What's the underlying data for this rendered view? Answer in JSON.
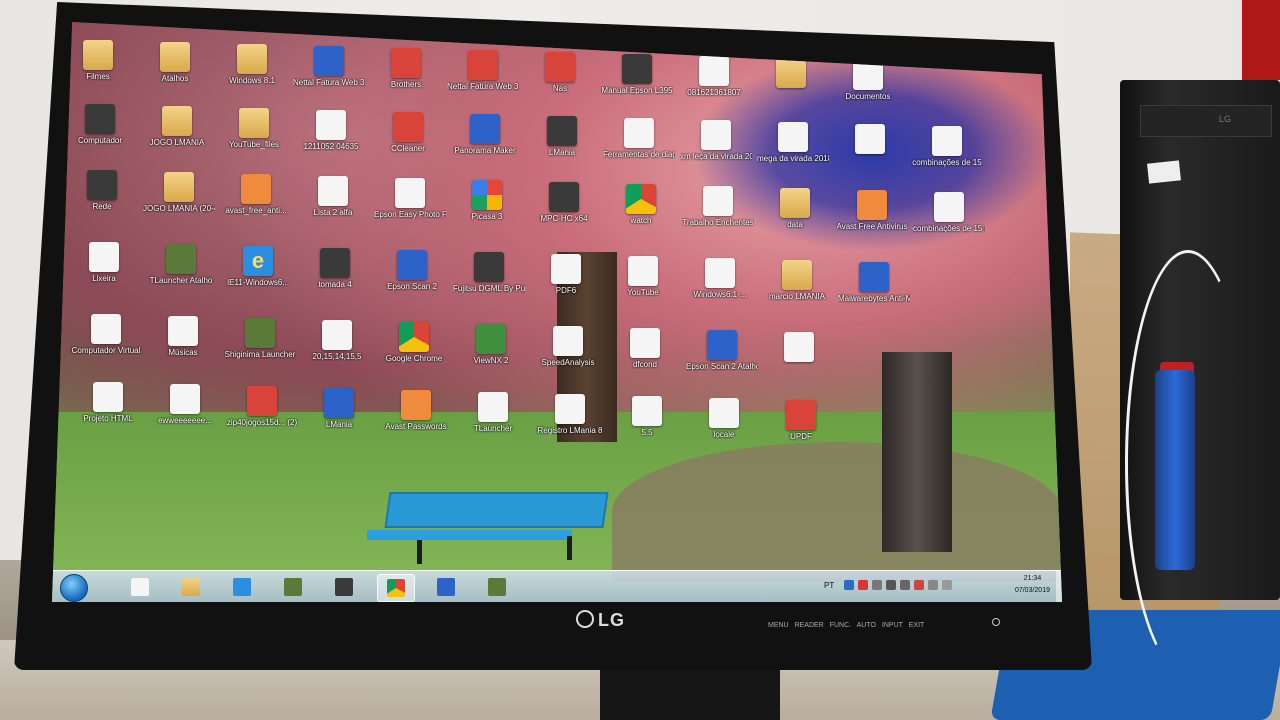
{
  "monitor": {
    "brand": "LG",
    "buttons": [
      "MENU",
      "READER",
      "FUNC.",
      "AUTO",
      "INPUT",
      "EXIT"
    ]
  },
  "desktop": {
    "icons": [
      {
        "name": "folder",
        "label": "Filmes",
        "glyph": "g-folder"
      },
      {
        "name": "folder",
        "label": "Atalhos",
        "glyph": "g-folder"
      },
      {
        "name": "folder",
        "label": "Windows 8.1",
        "glyph": "g-folder"
      },
      {
        "name": "app",
        "label": "Nettal Fatura Web 3.0",
        "glyph": "g-blue"
      },
      {
        "name": "app",
        "label": "Brothers",
        "glyph": "g-red"
      },
      {
        "name": "app",
        "label": "Nettal Fatura Web 3.0",
        "glyph": "g-red"
      },
      {
        "name": "app",
        "label": "Nas",
        "glyph": "g-red"
      },
      {
        "name": "app",
        "label": "Manual Epson L395",
        "glyph": "g-dark"
      },
      {
        "name": "doc",
        "label": "081621361807",
        "glyph": "g-doc"
      },
      {
        "name": "folder",
        "label": "",
        "glyph": "g-folder"
      },
      {
        "name": "doc",
        "label": "Documentos",
        "glyph": "g-doc"
      },
      {
        "name": "computer",
        "label": "Computador",
        "glyph": "g-dark"
      },
      {
        "name": "folder",
        "label": "JOGO LMANIA",
        "glyph": "g-folder"
      },
      {
        "name": "folder",
        "label": "YouTube_files",
        "glyph": "g-folder"
      },
      {
        "name": "app",
        "label": "1211052 04635",
        "glyph": "g-doc"
      },
      {
        "name": "app",
        "label": "CCleaner",
        "glyph": "g-red"
      },
      {
        "name": "app",
        "label": "Panorama Maker",
        "glyph": "g-blue"
      },
      {
        "name": "app",
        "label": "LMania",
        "glyph": "g-dark"
      },
      {
        "name": "doc",
        "label": "Ferramentas de diagnóstico d...",
        "glyph": "g-doc"
      },
      {
        "name": "doc",
        "label": "xm leça da virada 2018",
        "glyph": "g-doc"
      },
      {
        "name": "doc",
        "label": "mega da virada 2018",
        "glyph": "g-doc"
      },
      {
        "name": "doc",
        "label": "",
        "glyph": "g-doc"
      },
      {
        "name": "doc",
        "label": "combinações de 15",
        "glyph": "g-doc"
      },
      {
        "name": "network",
        "label": "Rede",
        "glyph": "g-dark"
      },
      {
        "name": "folder",
        "label": "JOGO LMANIA (20-40)",
        "glyph": "g-folder"
      },
      {
        "name": "app",
        "label": "avast_free_anti...",
        "glyph": "g-orange"
      },
      {
        "name": "doc",
        "label": "Lista 2 alfa",
        "glyph": "g-doc"
      },
      {
        "name": "app",
        "label": "Epson Easy Photo Print",
        "glyph": "g-doc"
      },
      {
        "name": "app",
        "label": "Picasa 3",
        "glyph": "g-picasa"
      },
      {
        "name": "app",
        "label": "MPC-HC x64",
        "glyph": "g-dark"
      },
      {
        "name": "app",
        "label": "watch",
        "glyph": "g-chrome"
      },
      {
        "name": "doc",
        "label": "Trabalho Enchentes",
        "glyph": "g-doc"
      },
      {
        "name": "folder",
        "label": "data",
        "glyph": "g-folder"
      },
      {
        "name": "app",
        "label": "Avast Free Antivirus",
        "glyph": "g-orange"
      },
      {
        "name": "doc",
        "label": "combinações de 15 dezenas (2)",
        "glyph": "g-doc"
      },
      {
        "name": "trash",
        "label": "Lixeira",
        "glyph": "g-doc"
      },
      {
        "name": "app",
        "label": "TLauncher Atalho",
        "glyph": "g-cube"
      },
      {
        "name": "app",
        "label": "IE11-Windows6...",
        "glyph": "g-ie"
      },
      {
        "name": "app",
        "label": "tomada 4",
        "glyph": "g-dark"
      },
      {
        "name": "app",
        "label": "Epson Scan 2",
        "glyph": "g-blue"
      },
      {
        "name": "app",
        "label": "Fujitsu DGML By Pulse 14",
        "glyph": "g-dark"
      },
      {
        "name": "doc",
        "label": "PDF6",
        "glyph": "g-doc"
      },
      {
        "name": "doc",
        "label": "YouTube",
        "glyph": "g-doc"
      },
      {
        "name": "app",
        "label": "Windows6.1-...",
        "glyph": "g-doc"
      },
      {
        "name": "folder",
        "label": "marcio LMANIA",
        "glyph": "g-folder"
      },
      {
        "name": "app",
        "label": "Malwarebytes Anti-Malware",
        "glyph": "g-blue"
      },
      {
        "name": "folder",
        "label": "Computador Virtual",
        "glyph": "g-doc"
      },
      {
        "name": "folder",
        "label": "Músicas",
        "glyph": "g-doc"
      },
      {
        "name": "app",
        "label": "Shiginima Launcher",
        "glyph": "g-cube"
      },
      {
        "name": "doc",
        "label": "20,15,14,15,5",
        "glyph": "g-doc"
      },
      {
        "name": "app",
        "label": "Google Chrome",
        "glyph": "g-chrome"
      },
      {
        "name": "app",
        "label": "ViewNX 2",
        "glyph": "g-green"
      },
      {
        "name": "doc",
        "label": "SpeedAnalysis",
        "glyph": "g-doc"
      },
      {
        "name": "doc",
        "label": "dfcond",
        "glyph": "g-doc"
      },
      {
        "name": "app",
        "label": "Epson Scan 2 Atalho",
        "glyph": "g-blue"
      },
      {
        "name": "folder",
        "label": "",
        "glyph": "g-doc"
      },
      {
        "name": "folder",
        "label": "Projeto HTML",
        "glyph": "g-doc"
      },
      {
        "name": "folder",
        "label": "ewweeeeeee...",
        "glyph": "g-doc"
      },
      {
        "name": "archive",
        "label": "zip40jogos15d... (2)",
        "glyph": "g-red"
      },
      {
        "name": "app",
        "label": "LMania",
        "glyph": "g-blue"
      },
      {
        "name": "app",
        "label": "Avast Passwords",
        "glyph": "g-orange"
      },
      {
        "name": "app",
        "label": "TLauncher",
        "glyph": "g-doc"
      },
      {
        "name": "doc",
        "label": "Registro LMania 8",
        "glyph": "g-doc"
      },
      {
        "name": "doc",
        "label": "5.5",
        "glyph": "g-doc"
      },
      {
        "name": "doc",
        "label": "locale",
        "glyph": "g-doc"
      },
      {
        "name": "app",
        "label": "UPDF",
        "glyph": "g-red"
      }
    ]
  },
  "taskbar": {
    "pinned": [
      {
        "name": "explorer-list",
        "glyph": "g-doc"
      },
      {
        "name": "folder",
        "glyph": "g-folder"
      },
      {
        "name": "ie",
        "glyph": "g-ie"
      },
      {
        "name": "minecraft",
        "glyph": "g-cube"
      },
      {
        "name": "tlauncher",
        "glyph": "g-dark"
      },
      {
        "name": "chrome",
        "glyph": "g-chrome"
      },
      {
        "name": "lmania",
        "glyph": "g-blue"
      },
      {
        "name": "minecraft-2",
        "glyph": "g-cube"
      }
    ],
    "language": "PT",
    "time": "21:34",
    "date": "07/03/2019"
  },
  "colors": {
    "taskbar": "#b8c9dc",
    "bezel": "#111111",
    "bench": "#2a9ad6"
  }
}
